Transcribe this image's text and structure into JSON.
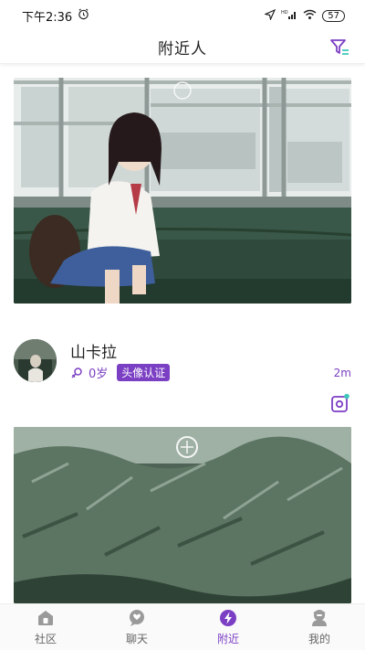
{
  "status_bar": {
    "time": "下午2:36",
    "network": "HD",
    "battery": "57"
  },
  "header": {
    "title": "附近人"
  },
  "feed": {
    "user": {
      "name": "山卡拉",
      "age": "0岁",
      "badge": "头像认证",
      "distance": "2m"
    }
  },
  "tabs": [
    {
      "label": "社区",
      "icon": "community-icon"
    },
    {
      "label": "聊天",
      "icon": "chat-icon"
    },
    {
      "label": "附近",
      "icon": "nearby-icon",
      "active": true
    },
    {
      "label": "我的",
      "icon": "profile-icon"
    }
  ],
  "colors": {
    "accent": "#7b3fc4",
    "tab_inactive": "#9a9a9a",
    "accent_teal": "#3cc7b8"
  }
}
